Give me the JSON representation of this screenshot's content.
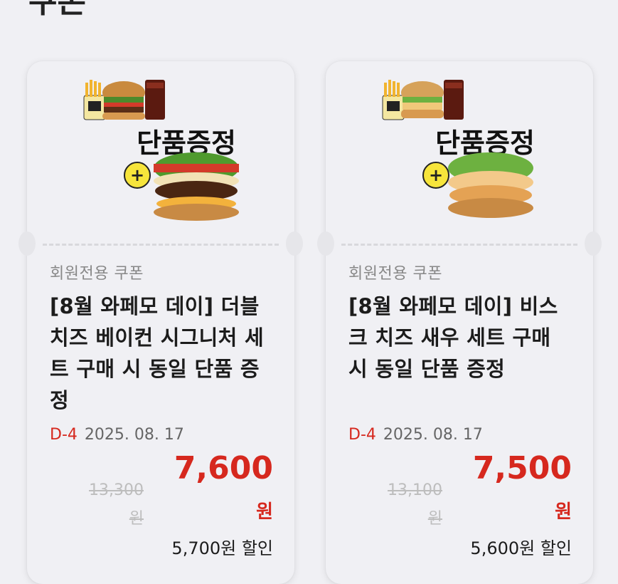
{
  "header": {
    "title_fragment": "쿠폰"
  },
  "coupons": [
    {
      "image_text": "단품증정",
      "label": "회원전용 쿠폰",
      "title": "[8월 와페모 데이] 더블치즈 베이컨 시그니처 세트 구매 시 동일 단품 증정",
      "dday": "D-4",
      "date": "2025. 08. 17",
      "price": "7,600",
      "price_unit": "원",
      "original_price": "13,300",
      "original_unit": "원",
      "discount": "5,700원 할인"
    },
    {
      "image_text": "단품증정",
      "label": "회원전용 쿠폰",
      "title": "[8월 와페모 데이] 비스크 치즈 새우 세트 구매 시 동일 단품 증정",
      "dday": "D-4",
      "date": "2025. 08. 17",
      "price": "7,500",
      "price_unit": "원",
      "original_price": "13,100",
      "original_unit": "원",
      "discount": "5,600원 할인"
    }
  ],
  "colors": {
    "accent": "#d6281e",
    "muted": "#bdbdbd",
    "background": "#f0f0f4"
  }
}
